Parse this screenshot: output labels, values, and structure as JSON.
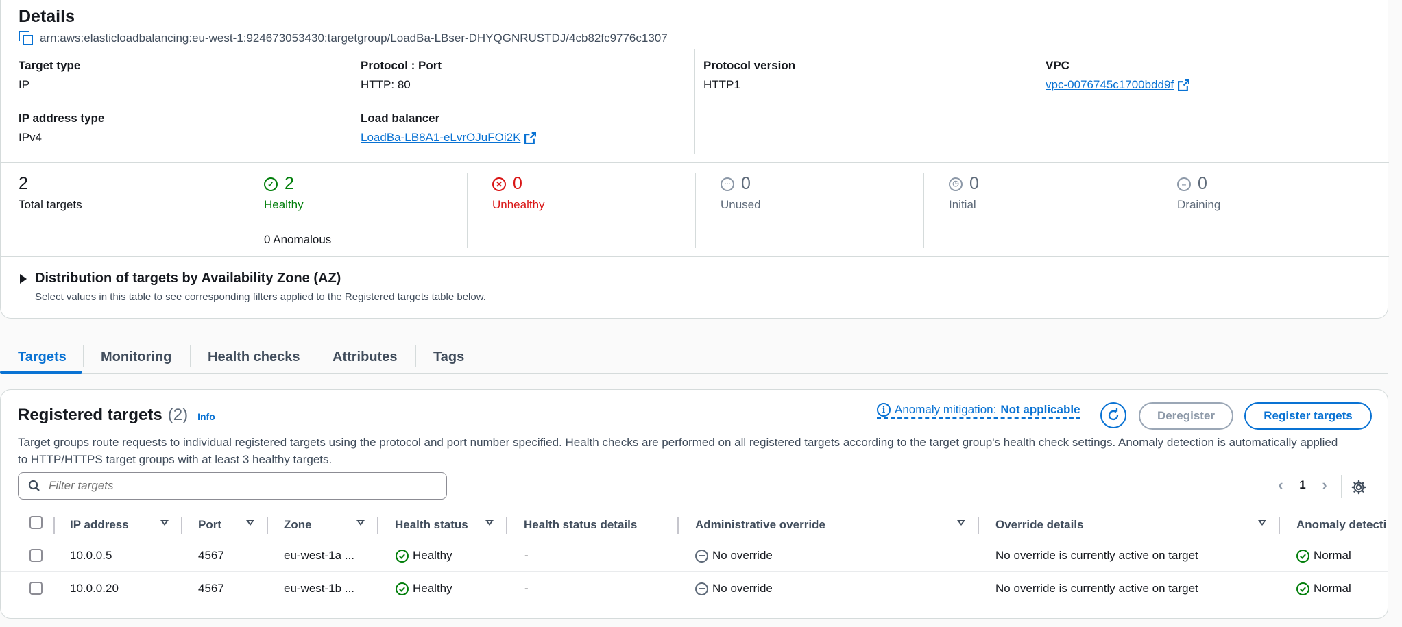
{
  "details": {
    "title": "Details",
    "arn": "arn:aws:elasticloadbalancing:eu-west-1:924673053430:targetgroup/LoadBa-LBser-DHYQGNRUSTDJ/4cb82fc9776c1307",
    "target_type": {
      "label": "Target type",
      "value": "IP"
    },
    "protocol_port": {
      "label": "Protocol : Port",
      "value": "HTTP: 80"
    },
    "protocol_version": {
      "label": "Protocol version",
      "value": "HTTP1"
    },
    "vpc": {
      "label": "VPC",
      "value": "vpc-0076745c1700bdd9f"
    },
    "ip_address_type": {
      "label": "IP address type",
      "value": "IPv4"
    },
    "load_balancer": {
      "label": "Load balancer",
      "value": "LoadBa-LB8A1-eLvrOJuFOi2K"
    }
  },
  "counts": {
    "total": {
      "value": "2",
      "label": "Total targets"
    },
    "healthy": {
      "value": "2",
      "label": "Healthy",
      "anomalous": "0 Anomalous"
    },
    "unhealthy": {
      "value": "0",
      "label": "Unhealthy"
    },
    "unused": {
      "value": "0",
      "label": "Unused"
    },
    "initial": {
      "value": "0",
      "label": "Initial"
    },
    "draining": {
      "value": "0",
      "label": "Draining"
    }
  },
  "az_distribution": {
    "title": "Distribution of targets by Availability Zone (AZ)",
    "description": "Select values in this table to see corresponding filters applied to the Registered targets table below."
  },
  "tabs": [
    "Targets",
    "Monitoring",
    "Health checks",
    "Attributes",
    "Tags"
  ],
  "active_tab": "Targets",
  "registered_targets": {
    "title": "Registered targets",
    "count": "(2)",
    "info": "Info",
    "anomaly_label": "Anomaly mitigation:",
    "anomaly_value": "Not applicable",
    "deregister": "Deregister",
    "register": "Register targets",
    "description": "Target groups route requests to individual registered targets using the protocol and port number specified. Health checks are performed on all registered targets according to the target group's health check settings. Anomaly detection is automatically applied to HTTP/HTTPS target groups with at least 3 healthy targets.",
    "filter_placeholder": "Filter targets",
    "page": "1",
    "columns": [
      "IP address",
      "Port",
      "Zone",
      "Health status",
      "Health status details",
      "Administrative override",
      "Override details",
      "Anomaly detecti"
    ],
    "rows": [
      {
        "ip": "10.0.0.5",
        "port": "4567",
        "zone": "eu-west-1a ...",
        "health": "Healthy",
        "health_details": "-",
        "admin_override": "No override",
        "override_details": "No override is currently active on target",
        "anomaly": "Normal"
      },
      {
        "ip": "10.0.0.20",
        "port": "4567",
        "zone": "eu-west-1b ...",
        "health": "Healthy",
        "health_details": "-",
        "admin_override": "No override",
        "override_details": "No override is currently active on target",
        "anomaly": "Normal"
      }
    ]
  },
  "colors": {
    "accent": "#0972d3",
    "success": "#037f0c",
    "error": "#d91515",
    "muted": "#5f6b7a"
  }
}
